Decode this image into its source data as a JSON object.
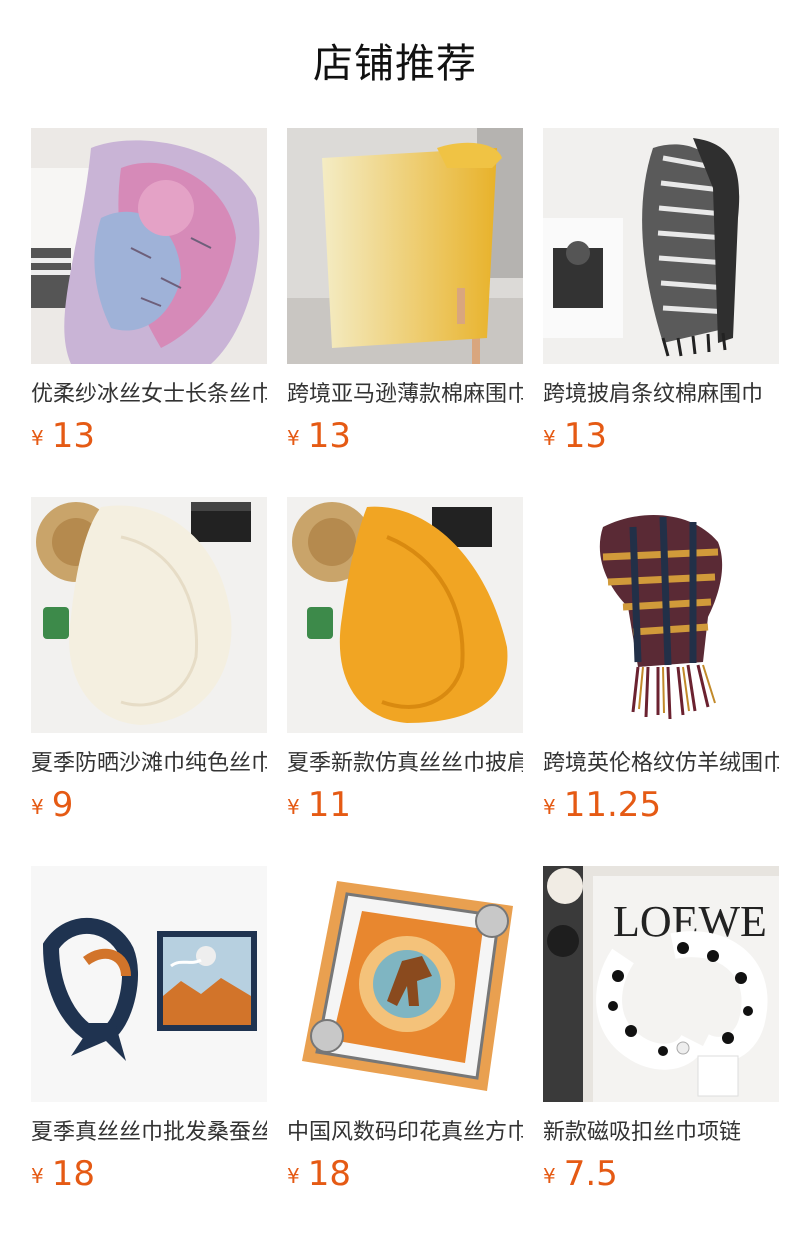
{
  "page": {
    "title": "店铺推荐"
  },
  "currency_symbol": "¥",
  "products": [
    {
      "name": "优柔纱冰丝女士长条丝巾",
      "price": "13"
    },
    {
      "name": "跨境亚马逊薄款棉麻围巾",
      "price": "13"
    },
    {
      "name": "跨境披肩条纹棉麻围巾",
      "price": "13"
    },
    {
      "name": "夏季防晒沙滩巾纯色丝巾",
      "price": "9"
    },
    {
      "name": "夏季新款仿真丝丝巾披肩",
      "price": "11"
    },
    {
      "name": "跨境英伦格纹仿羊绒围巾",
      "price": "11.25"
    },
    {
      "name": "夏季真丝丝巾批发桑蚕丝",
      "price": "18"
    },
    {
      "name": "中国风数码印花真丝方巾",
      "price": "18"
    },
    {
      "name": "新款磁吸扣丝巾项链",
      "price": "7.5"
    }
  ]
}
